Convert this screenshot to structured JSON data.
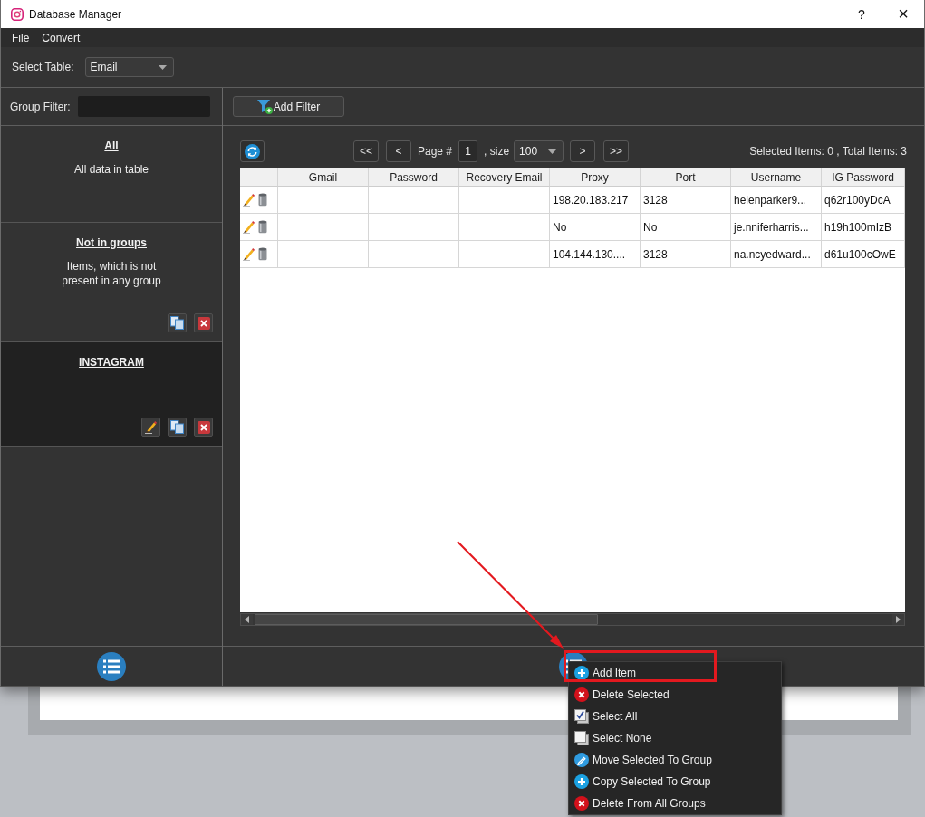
{
  "window": {
    "title": "Database Manager",
    "help": "?",
    "close": "×"
  },
  "menu_bar": [
    "File",
    "Convert"
  ],
  "table_selector": {
    "label": "Select Table:",
    "value": "Email"
  },
  "group_filter": {
    "label": "Group Filter:"
  },
  "groups": [
    {
      "title": "All",
      "description": "All data in table",
      "selected": false
    },
    {
      "title": "Not in groups",
      "description": "Items, which is not\npresent in any group",
      "selected": false,
      "actions": [
        {
          "kind": "copy"
        },
        {
          "kind": "delete"
        }
      ]
    },
    {
      "title": "INSTAGRAM",
      "selected": true,
      "actions": [
        {
          "kind": "edit"
        },
        {
          "kind": "copy"
        },
        {
          "kind": "delete"
        }
      ]
    }
  ],
  "filter_button": "Add Filter",
  "pagination": {
    "first": "<<",
    "previous": "<",
    "page_label": "Page #",
    "page": "1",
    "size_label": ", size",
    "size": "100",
    "next": ">",
    "last": ">>"
  },
  "selection_summary": "Selected Items: 0 , Total Items: 3",
  "table": {
    "columns": [
      "Gmail",
      "Password",
      "Recovery Email",
      "Proxy",
      "Port",
      "Username",
      "IG Password"
    ],
    "rows": [
      {
        "cells": [
          null,
          null,
          null,
          "198.20.183.217",
          "3128",
          "helenparker9...",
          "q62r100yDcA"
        ]
      },
      {
        "cells": [
          null,
          null,
          null,
          "No",
          "No",
          "je.nniferharris...",
          "h19h100mIzB"
        ]
      },
      {
        "cells": [
          null,
          null,
          null,
          "104.144.130....",
          "3128",
          "na.ncyedward...",
          "d61u100cOwE"
        ]
      }
    ]
  },
  "context_menu": {
    "items": [
      {
        "label": "Add Item",
        "kind": "plus",
        "highlighted": true
      },
      {
        "label": "Delete Selected",
        "kind": "cross",
        "highlighted": false
      },
      {
        "label": "Select All",
        "kind": "checked",
        "highlighted": false
      },
      {
        "label": "Select None",
        "kind": "unchecked",
        "highlighted": false
      },
      {
        "label": "Move Selected To Group",
        "kind": "pencil",
        "highlighted": false
      },
      {
        "label": "Copy Selected To Group",
        "kind": "plus",
        "highlighted": false
      },
      {
        "label": "Delete From All Groups",
        "kind": "cross",
        "highlighted": false
      }
    ]
  }
}
